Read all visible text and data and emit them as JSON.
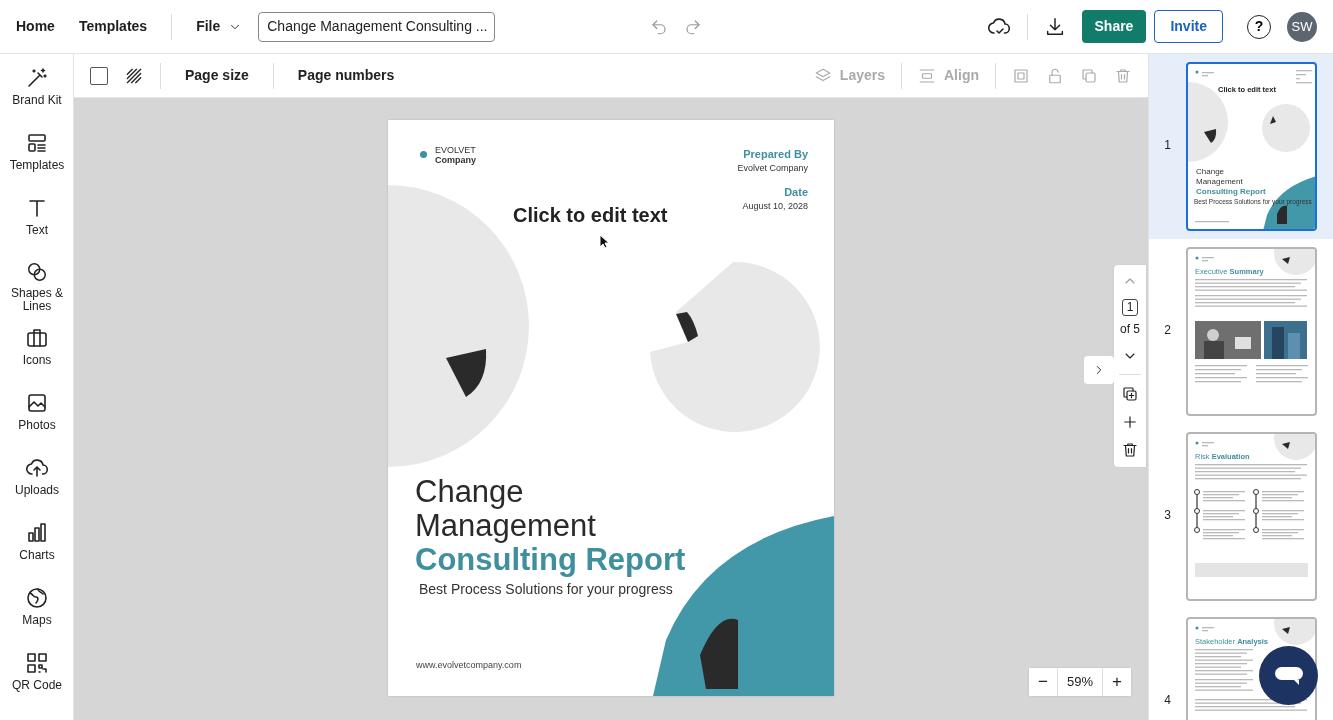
{
  "top_nav": {
    "links": [
      "Home",
      "Templates"
    ],
    "file_menu": "File",
    "doc_title": "Change Management Consulting ...",
    "share": "Share",
    "invite": "Invite",
    "help": "?",
    "avatar": "SW"
  },
  "sidebar": {
    "items": [
      {
        "label": "Brand Kit",
        "kind": "wand"
      },
      {
        "label": "Templates",
        "kind": "templates"
      },
      {
        "label": "Text",
        "kind": "text"
      },
      {
        "label": "Shapes & Lines",
        "kind": "shapes"
      },
      {
        "label": "Icons",
        "kind": "icons"
      },
      {
        "label": "Photos",
        "kind": "photos"
      },
      {
        "label": "Uploads",
        "kind": "uploads"
      },
      {
        "label": "Charts",
        "kind": "charts"
      },
      {
        "label": "Maps",
        "kind": "maps"
      },
      {
        "label": "QR Code",
        "kind": "qr"
      }
    ]
  },
  "toolbar": {
    "buttons": [
      {
        "label": "Page size"
      },
      {
        "label": "Page numbers"
      }
    ],
    "layers": {
      "label": "Layers",
      "disabled": true
    },
    "align": {
      "label": "Align",
      "disabled": true
    }
  },
  "page": {
    "brand_top": "EVOLVET",
    "brand_bottom": "Company",
    "prepared_label": "Prepared By",
    "prepared_value": "Evolvet Company",
    "date_label": "Date",
    "date_value": "August 10, 2028",
    "edit_text": "Click to edit text",
    "title_lines": [
      "Change",
      "Management"
    ],
    "title_accent": "Consulting Report",
    "subtitle": "Best Process Solutions for your progress",
    "website": "www.evolvetcompany.com"
  },
  "page_nav": {
    "current": "1",
    "total": "of 5"
  },
  "zoom": {
    "value": "59%",
    "minus": "−",
    "plus": "+"
  },
  "thumbnails": [
    {
      "number": "1",
      "selected": true,
      "kind": "cover",
      "edit_text": "Click to edit text",
      "title_lines": [
        "Change",
        "Management"
      ],
      "title_accent": "Consulting Report",
      "subtitle": "Best Process Solutions for your progress"
    },
    {
      "number": "2",
      "selected": false,
      "kind": "photos",
      "heading": "Executive **Summary**"
    },
    {
      "number": "3",
      "selected": false,
      "kind": "timeline",
      "heading": "Risk **Evaluation**"
    },
    {
      "number": "4",
      "selected": false,
      "kind": "text",
      "heading": "Stakeholder **Analysis**"
    }
  ]
}
